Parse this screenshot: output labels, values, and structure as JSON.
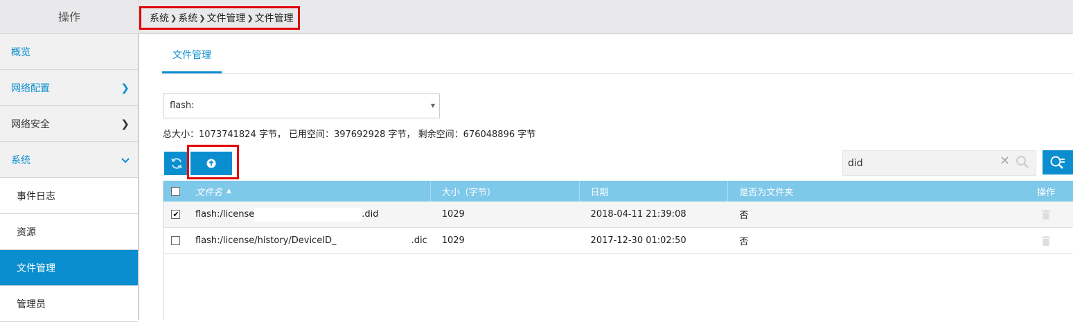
{
  "header": {
    "op_title": "操作",
    "breadcrumb": [
      "系统",
      "系统",
      "文件管理",
      "文件管理"
    ]
  },
  "sidebar": {
    "items": [
      {
        "label": "概览",
        "chevron": ""
      },
      {
        "label": "网络配置",
        "chevron": "right"
      },
      {
        "label": "网络安全",
        "chevron": "right"
      },
      {
        "label": "系统",
        "chevron": "down"
      }
    ],
    "sub_items": [
      {
        "label": "事件日志",
        "active": false
      },
      {
        "label": "资源",
        "active": false
      },
      {
        "label": "文件管理",
        "active": true
      },
      {
        "label": "管理员",
        "active": false
      }
    ]
  },
  "main": {
    "tab_label": "文件管理",
    "storage_select": "flash:",
    "summary": "总大小：1073741824 字节， 已用空间：397692928 字节， 剩余空间：676048896 字节",
    "search": {
      "value": "did"
    }
  },
  "table": {
    "headers": {
      "name": "文件名",
      "size": "大小（字节）",
      "date": "日期",
      "folder": "是否为文件夹",
      "op": "操作"
    },
    "rows": [
      {
        "name_prefix": "flash:/license",
        "name_suffix": ".did",
        "size": "1029",
        "date": "2018-04-11 21:39:08",
        "folder": "否",
        "checked": true
      },
      {
        "name_prefix": "flash:/license/history/DeviceID_",
        "name_suffix": ".dic",
        "size": "1029",
        "date": "2017-12-30 01:02:50",
        "folder": "否",
        "checked": false
      }
    ]
  },
  "colors": {
    "accent": "#0a8ed0",
    "table_header": "#7ec8ea",
    "highlight": "#e00000"
  }
}
